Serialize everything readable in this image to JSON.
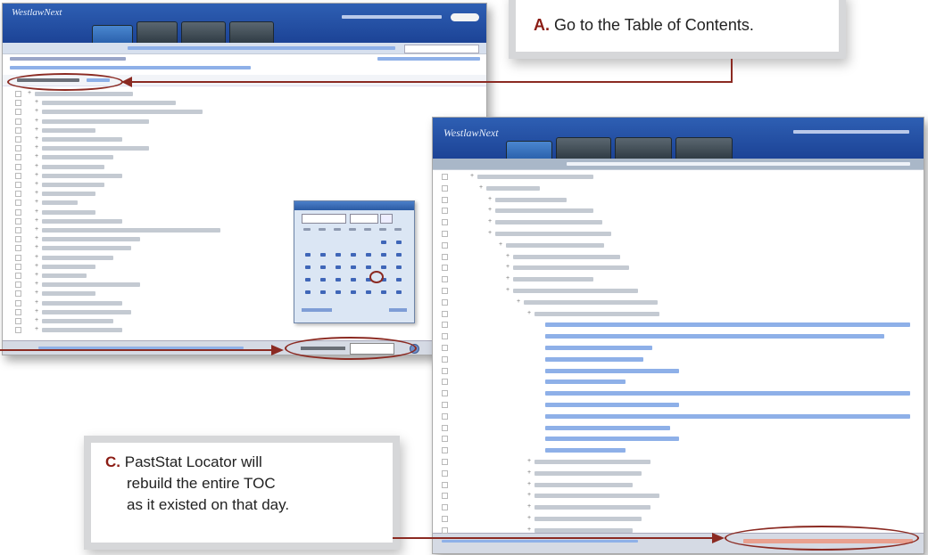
{
  "callout_a": {
    "letter": "A.",
    "text": "Go to the Table of Contents."
  },
  "callout_c": {
    "letter": "C.",
    "lines": [
      "PastStat Locator will",
      "rebuild the entire TOC",
      "as it existed on that day."
    ]
  },
  "colors": {
    "accent_red": "#8b2a22",
    "header_blue": "#1c4396",
    "tab_dark": "#3a4650",
    "link_blue": "#2a53a3"
  },
  "icons": [
    "calendar-picker-icon",
    "go-arrow-icon",
    "expand-plus-icon",
    "checkbox-icon"
  ],
  "screenshot_back": {
    "logo": "WestlawNext"
  },
  "screenshot_front": {
    "logo": "WestlawNext"
  }
}
